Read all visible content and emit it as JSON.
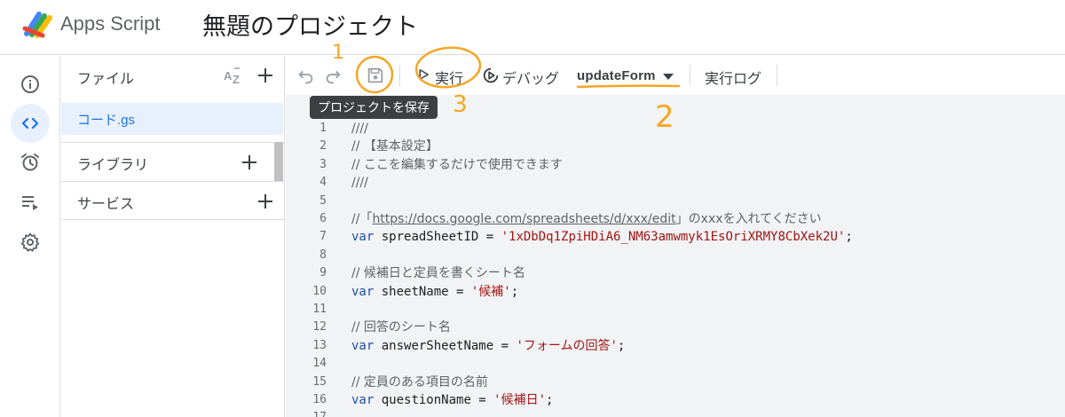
{
  "header": {
    "app_name": "Apps Script",
    "project_title": "無題のプロジェクト"
  },
  "rail": {
    "items": [
      {
        "icon": "info-icon",
        "active": false
      },
      {
        "icon": "code-icon",
        "active": true
      },
      {
        "icon": "alarm-clock-icon",
        "active": false
      },
      {
        "icon": "playlist-icon",
        "active": false
      },
      {
        "icon": "gear-icon",
        "active": false
      }
    ]
  },
  "files": {
    "title": "ファイル",
    "sort_label": "AZ",
    "active_file": "コード.gs",
    "sections": [
      "ライブラリ",
      "サービス"
    ]
  },
  "toolbar": {
    "run_label": "実行",
    "debug_label": "デバッグ",
    "function_name": "updateForm",
    "log_label": "実行ログ",
    "save_tooltip": "プロジェクトを保存"
  },
  "code": {
    "lines": [
      {
        "n": "1",
        "parts": [
          {
            "c": "cmt",
            "t": "////"
          }
        ]
      },
      {
        "n": "2",
        "parts": [
          {
            "c": "cmt",
            "t": "// 【基本設定】"
          }
        ]
      },
      {
        "n": "3",
        "parts": [
          {
            "c": "cmt",
            "t": "// ここを編集するだけで使用できます"
          }
        ]
      },
      {
        "n": "4",
        "parts": [
          {
            "c": "cmt",
            "t": "////"
          }
        ]
      },
      {
        "n": "5",
        "parts": []
      },
      {
        "n": "6",
        "parts": [
          {
            "c": "cmt",
            "t": "//「"
          },
          {
            "c": "cmt url",
            "t": "https://docs.google.com/spreadsheets/d/xxx/edit"
          },
          {
            "c": "cmt",
            "t": "」のxxxを入れてください"
          }
        ]
      },
      {
        "n": "7",
        "parts": [
          {
            "c": "kw",
            "t": "var"
          },
          {
            "c": "",
            "t": " spreadSheetID = "
          },
          {
            "c": "str",
            "t": "'1xDbDq1ZpiHDiA6_NM63amwmyk1EsOriXRMY8CbXek2U'"
          },
          {
            "c": "",
            "t": ";"
          }
        ]
      },
      {
        "n": "8",
        "parts": []
      },
      {
        "n": "9",
        "parts": [
          {
            "c": "cmt",
            "t": "// 候補日と定員を書くシート名"
          }
        ]
      },
      {
        "n": "10",
        "parts": [
          {
            "c": "kw",
            "t": "var"
          },
          {
            "c": "",
            "t": " sheetName = "
          },
          {
            "c": "str",
            "t": "'候補'"
          },
          {
            "c": "",
            "t": ";"
          }
        ]
      },
      {
        "n": "11",
        "parts": []
      },
      {
        "n": "12",
        "parts": [
          {
            "c": "cmt",
            "t": "// 回答のシート名"
          }
        ]
      },
      {
        "n": "13",
        "parts": [
          {
            "c": "kw",
            "t": "var"
          },
          {
            "c": "",
            "t": " answerSheetName = "
          },
          {
            "c": "str",
            "t": "'フォームの回答'"
          },
          {
            "c": "",
            "t": ";"
          }
        ]
      },
      {
        "n": "14",
        "parts": []
      },
      {
        "n": "15",
        "parts": [
          {
            "c": "cmt",
            "t": "// 定員のある項目の名前"
          }
        ]
      },
      {
        "n": "16",
        "parts": [
          {
            "c": "kw",
            "t": "var"
          },
          {
            "c": "",
            "t": " questionName = "
          },
          {
            "c": "str",
            "t": "'候補日'"
          },
          {
            "c": "",
            "t": ";"
          }
        ]
      },
      {
        "n": "17",
        "parts": []
      }
    ]
  },
  "annotations": {
    "marks": [
      "1",
      "2",
      "3"
    ],
    "color": "#f5a623"
  }
}
